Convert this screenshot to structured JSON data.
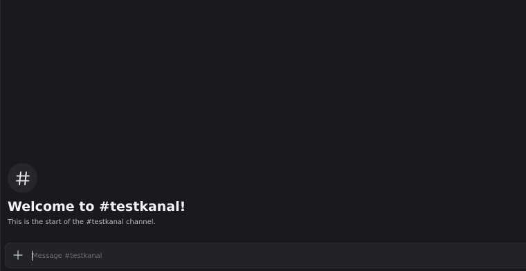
{
  "channel": {
    "name": "testkanal",
    "icon": "hashtag-icon"
  },
  "welcome": {
    "title": "Welcome to #testkanal!",
    "subtitle": "This is the start of the #testkanal channel."
  },
  "composer": {
    "attach_icon": "plus-icon",
    "placeholder": "Message #testkanal",
    "value": ""
  },
  "colors": {
    "background": "#1a1a1e",
    "composer_background": "#222327",
    "title": "#f2f3f5",
    "subtitle": "#b5bac1",
    "placeholder": "#6d6f78"
  }
}
